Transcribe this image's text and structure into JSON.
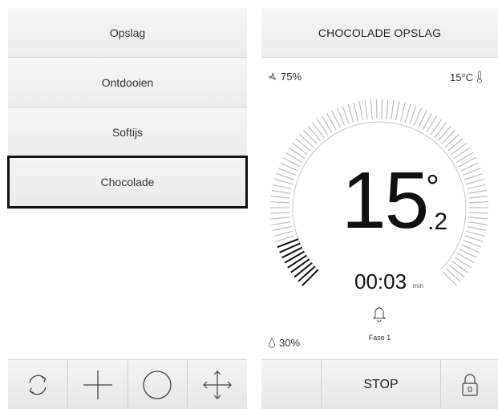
{
  "menu": {
    "items": [
      {
        "label": "Opslag",
        "selected": false
      },
      {
        "label": "Ontdooien",
        "selected": false
      },
      {
        "label": "Softijs",
        "selected": false
      },
      {
        "label": "Chocolade",
        "selected": true
      }
    ]
  },
  "left_toolbar": {
    "icons": [
      "refresh-icon",
      "plus-icon",
      "circle-icon",
      "move-icon"
    ]
  },
  "program": {
    "title": "CHOCOLADE OPSLAG",
    "fan_speed": "75%",
    "temperature_setpoint": "15°C",
    "humidity": "30%",
    "temperature_main": "15",
    "temperature_degree": "°",
    "temperature_decimal": ".2",
    "timer": "00:03",
    "timer_unit": "min",
    "phase": "Fase 1",
    "stop_label": "STOP",
    "dial_progress": 0.1
  },
  "colors": {
    "accent": "#111111",
    "tick_inactive": "#b8b8b8",
    "panel_bg": "#efefef"
  }
}
